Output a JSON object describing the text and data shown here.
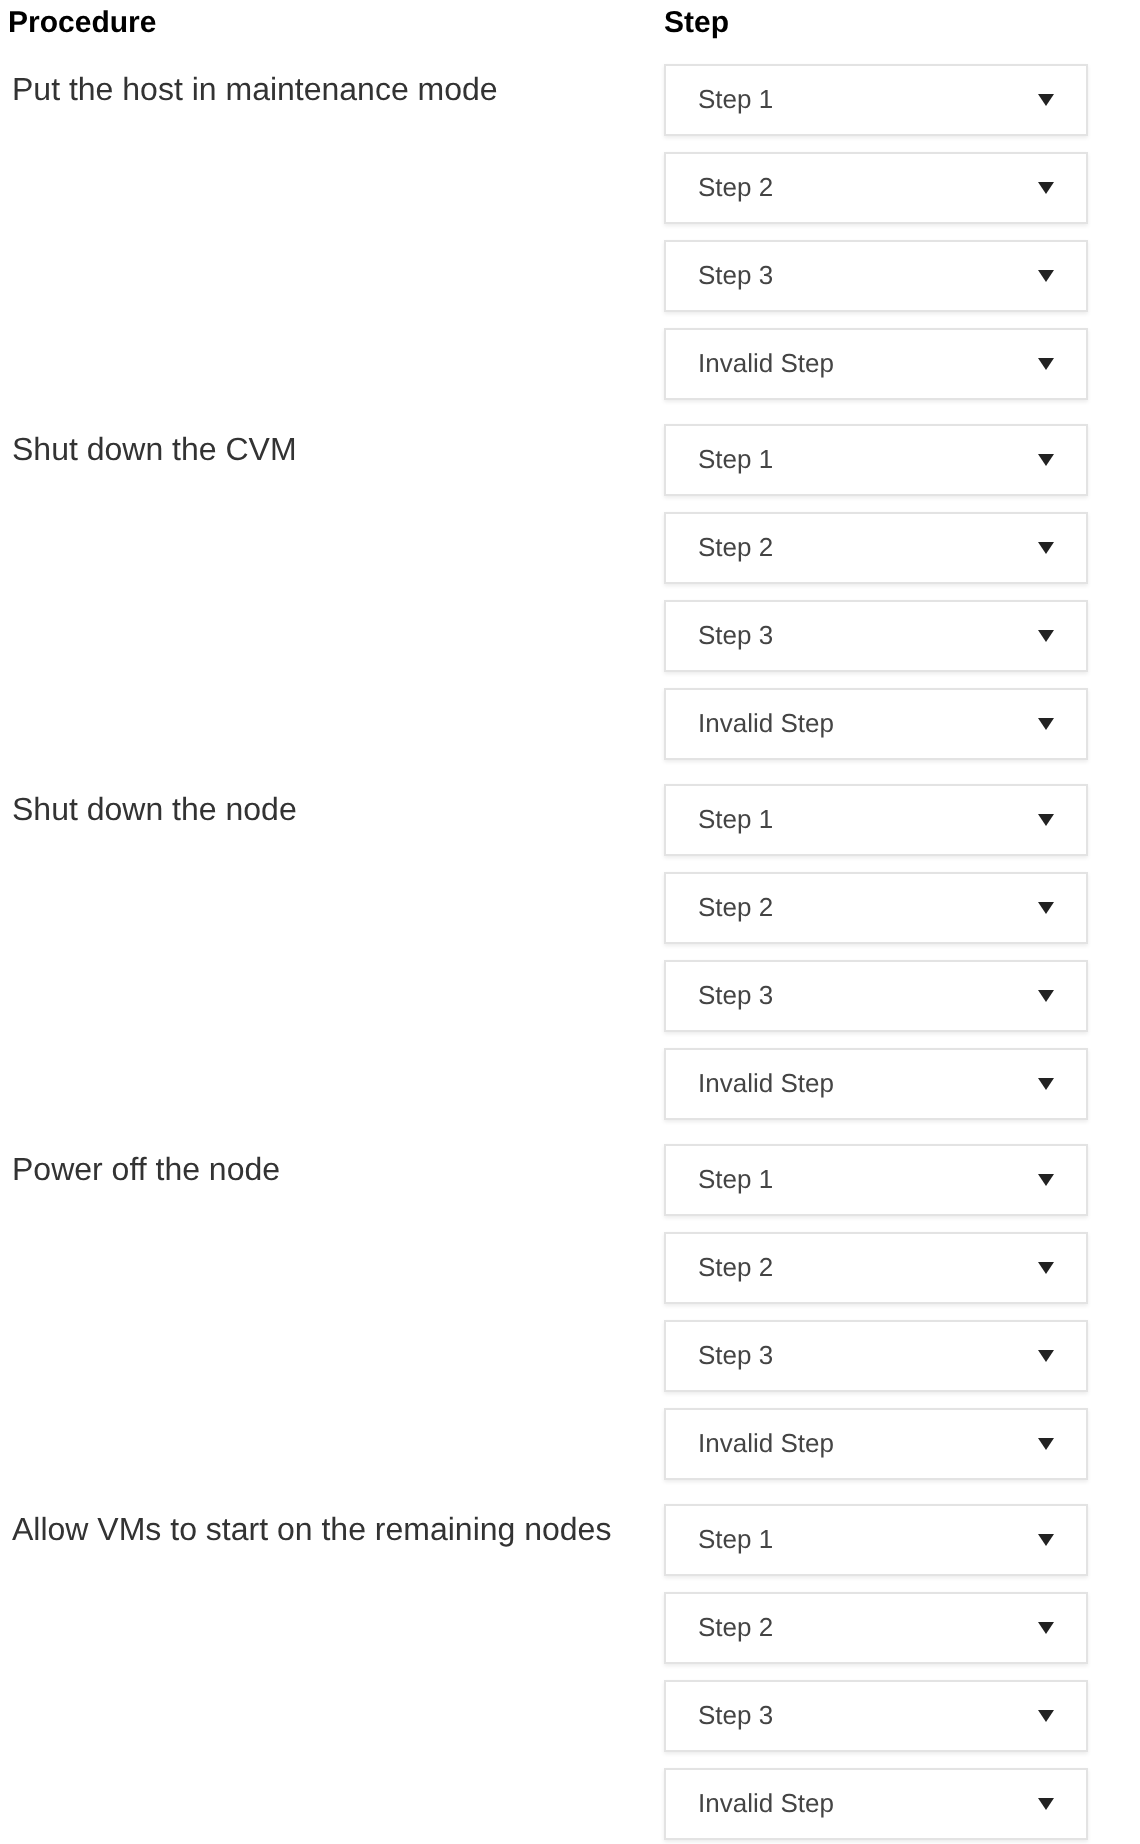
{
  "header": {
    "procedure": "Procedure",
    "step": "Step"
  },
  "procedures": [
    {
      "label": "Put the host in maintenance mode",
      "selects": [
        "Step 1",
        "Step 2",
        "Step 3",
        "Invalid Step"
      ]
    },
    {
      "label": "Shut down the CVM",
      "selects": [
        "Step 1",
        "Step 2",
        "Step 3",
        "Invalid Step"
      ]
    },
    {
      "label": "Shut down the node",
      "selects": [
        "Step 1",
        "Step 2",
        "Step 3",
        "Invalid Step"
      ]
    },
    {
      "label": "Power off the node",
      "selects": [
        "Step 1",
        "Step 2",
        "Step 3",
        "Invalid Step"
      ]
    },
    {
      "label": "Allow VMs to start on the remaining nodes",
      "selects": [
        "Step 1",
        "Step 2",
        "Step 3",
        "Invalid Step"
      ]
    }
  ]
}
